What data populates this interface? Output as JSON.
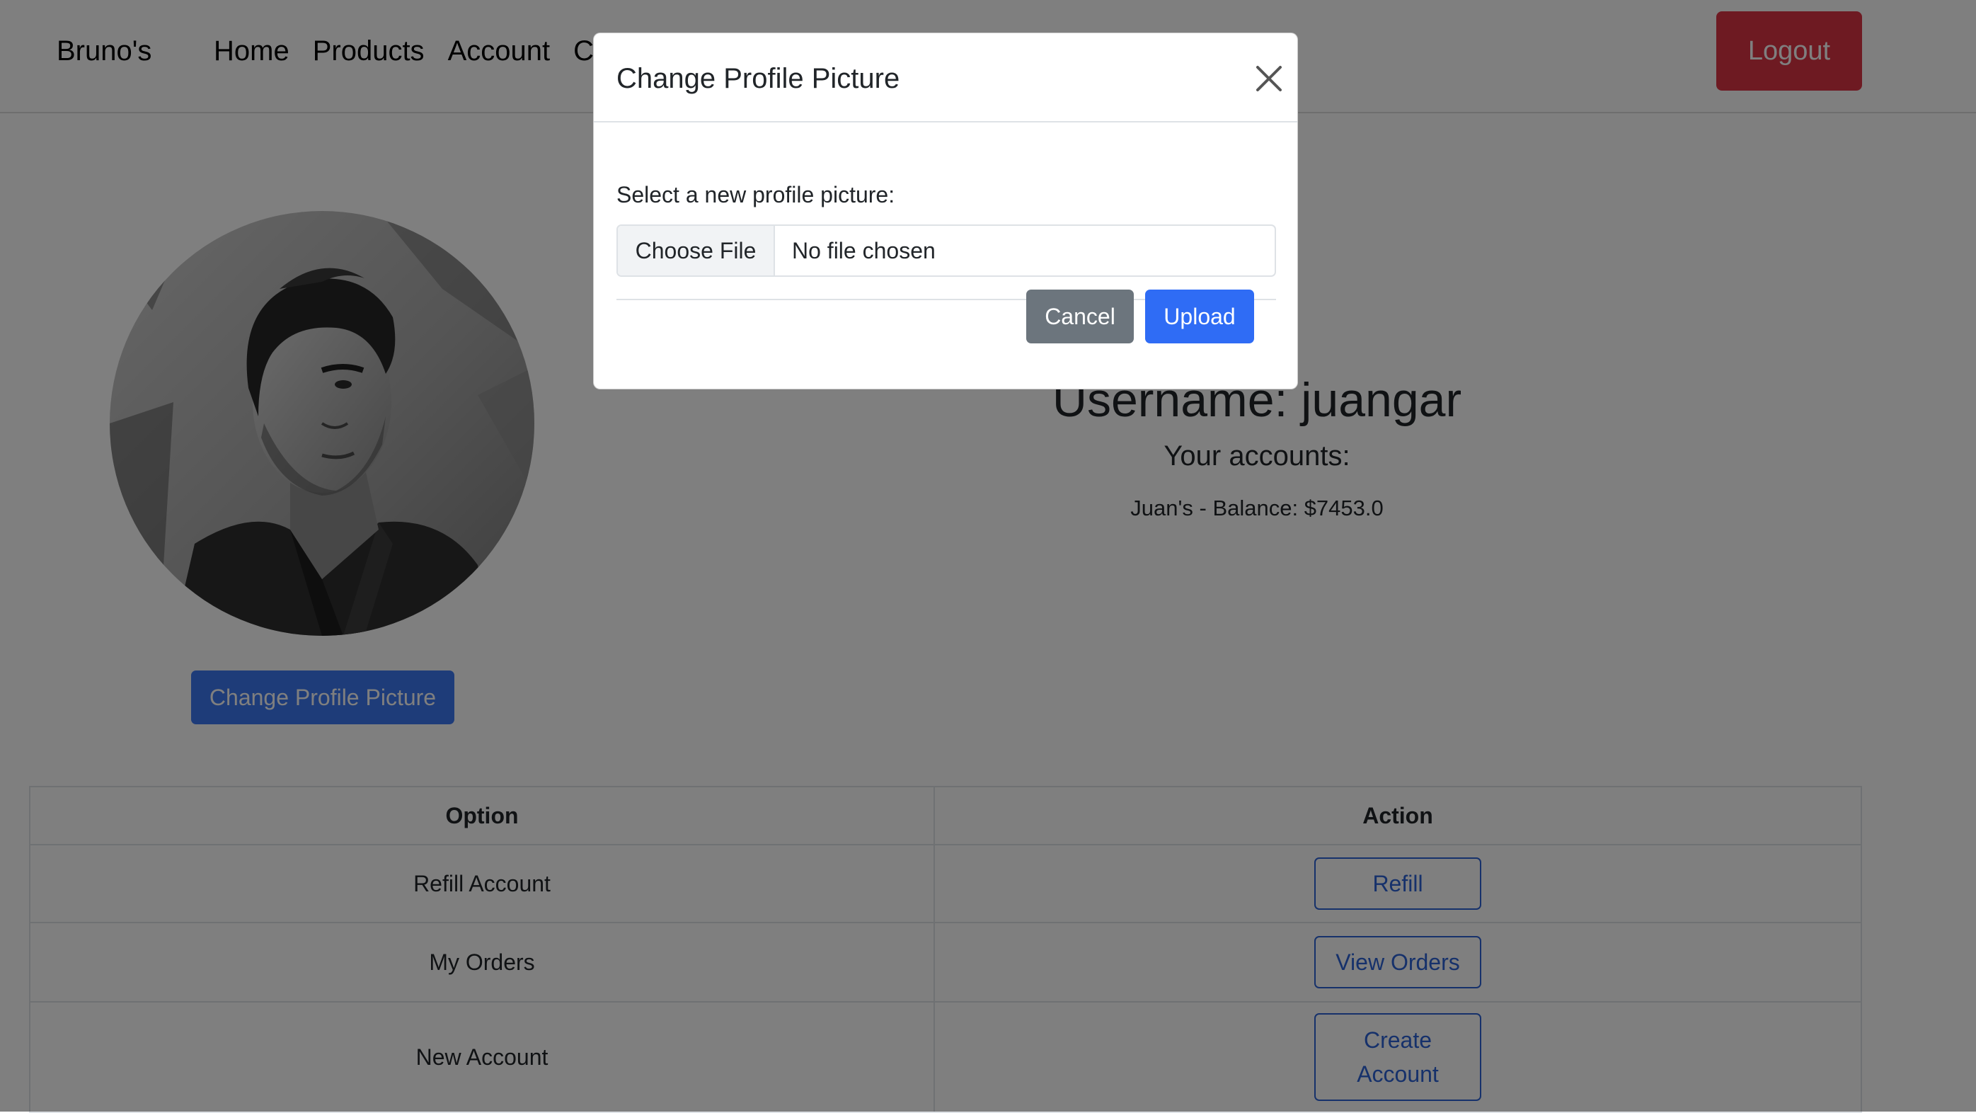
{
  "navbar": {
    "brand": "Bruno's",
    "links": [
      "Home",
      "Products",
      "Account",
      "C"
    ],
    "logout_label": "Logout"
  },
  "profile": {
    "change_picture_label": "Change Profile Picture",
    "username_line": "Username: juangar",
    "accounts_title": "Your accounts:",
    "accounts": [
      "Juan's - Balance: $7453.0"
    ]
  },
  "table": {
    "headers": [
      "Option",
      "Action"
    ],
    "rows": [
      {
        "option": "Refill Account",
        "action": "Refill"
      },
      {
        "option": "My Orders",
        "action": "View Orders"
      },
      {
        "option": "New Account",
        "action": "Create Account"
      }
    ]
  },
  "modal": {
    "title": "Change Profile Picture",
    "label": "Select a new profile picture:",
    "file_button": "Choose File",
    "file_status": "No file chosen",
    "cancel_label": "Cancel",
    "upload_label": "Upload"
  },
  "colors": {
    "primary": "#3d78f3",
    "danger": "#dc3545",
    "secondary": "#6c757d",
    "backdrop": "rgba(0,0,0,0.5)"
  },
  "icons": {
    "close": "close-icon"
  }
}
